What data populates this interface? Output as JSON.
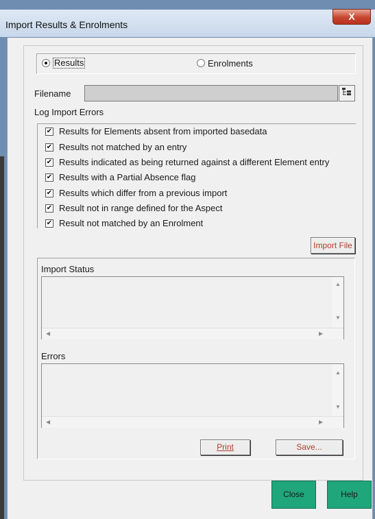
{
  "window": {
    "title": "Import Results & Enrolments",
    "close_glyph": "X"
  },
  "mode": {
    "options": [
      {
        "label": "Results",
        "selected": true
      },
      {
        "label": "Enrolments",
        "selected": false
      }
    ]
  },
  "filename": {
    "label": "Filename",
    "value": "",
    "browse_icon": "folder-tree-icon"
  },
  "log_errors": {
    "label": "Log Import Errors",
    "items": [
      {
        "label": "Results for Elements absent from imported basedata",
        "checked": true
      },
      {
        "label": "Results not matched by an entry",
        "checked": true
      },
      {
        "label": "Results indicated as being returned against a different Element entry",
        "checked": true
      },
      {
        "label": "Results with a Partial Absence flag",
        "checked": true
      },
      {
        "label": "Results which differ from a previous import",
        "checked": true
      },
      {
        "label": "Result not in range defined for the Aspect",
        "checked": true
      },
      {
        "label": "Result not matched by an Enrolment",
        "checked": true
      }
    ]
  },
  "import_file_label": "Import File",
  "import_status": {
    "label": "Import Status",
    "text": ""
  },
  "errors": {
    "label": "Errors",
    "text": ""
  },
  "actions": {
    "print_label": "Print",
    "save_label": "Save..."
  },
  "footer": {
    "close_label": "Close",
    "help_label": "Help"
  },
  "colors": {
    "accent_text": "#b53a2a",
    "footer_button": "#1fa67a",
    "close_button": "#c8452f"
  }
}
